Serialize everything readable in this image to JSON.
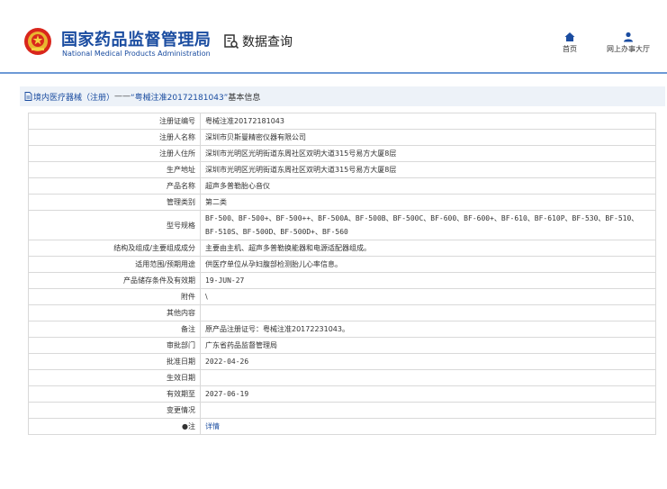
{
  "header": {
    "title_cn": "国家药品监督管理局",
    "title_en": "National Medical Products Administration",
    "section": "数据查询",
    "nav": [
      {
        "label": "首页",
        "icon": "home-icon"
      },
      {
        "label": "网上办事大厅",
        "icon": "user-icon"
      }
    ]
  },
  "breadcrumb": {
    "part1": "境内医疗器械（注册）",
    "sep": " —— ",
    "part2": "“粤械注准20172181043”",
    "part3": " 基本信息"
  },
  "rows": [
    {
      "key": "注册证编号",
      "value": "粤械注准20172181043"
    },
    {
      "key": "注册人名称",
      "value": "深圳市贝斯曼精密仪器有限公司"
    },
    {
      "key": "注册人住所",
      "value": "深圳市光明区光明街道东周社区双明大道315号易方大厦8层"
    },
    {
      "key": "生产地址",
      "value": "深圳市光明区光明街道东周社区双明大道315号易方大厦8层"
    },
    {
      "key": "产品名称",
      "value": "超声多普勒胎心音仪"
    },
    {
      "key": "管理类别",
      "value": "第二类"
    },
    {
      "key": "型号规格",
      "value": "BF-500、BF-500+、BF-500++、BF-500A、BF-500B、BF-500C、BF-600、BF-600+、BF-610、BF-610P、BF-530、BF-510、BF-510S、BF-500D、BF-500D+、BF-560"
    },
    {
      "key": "结构及组成/主要组成成分",
      "value": "主要由主机、超声多普勒换能器和电源适配器组成。"
    },
    {
      "key": "适用范围/预期用途",
      "value": "供医疗单位从孕妇腹部检测胎儿心率信息。"
    },
    {
      "key": "产品储存条件及有效期",
      "value": "19-JUN-27"
    },
    {
      "key": "附件",
      "value": "\\"
    },
    {
      "key": "其他内容",
      "value": ""
    },
    {
      "key": "备注",
      "value": "原产品注册证号：粤械注准20172231043。"
    },
    {
      "key": "审批部门",
      "value": "广东省药品监督管理局"
    },
    {
      "key": "批准日期",
      "value": "2022-04-26"
    },
    {
      "key": "生效日期",
      "value": ""
    },
    {
      "key": "有效期至",
      "value": "2027-06-19"
    },
    {
      "key": "变更情况",
      "value": ""
    },
    {
      "key": "注",
      "value": "详情",
      "key_marker": "●"
    }
  ],
  "colors": {
    "brand_blue": "#1a4ca0",
    "header_line": "#6d9ad6",
    "breadcrumb_bg": "#edf2f8"
  }
}
